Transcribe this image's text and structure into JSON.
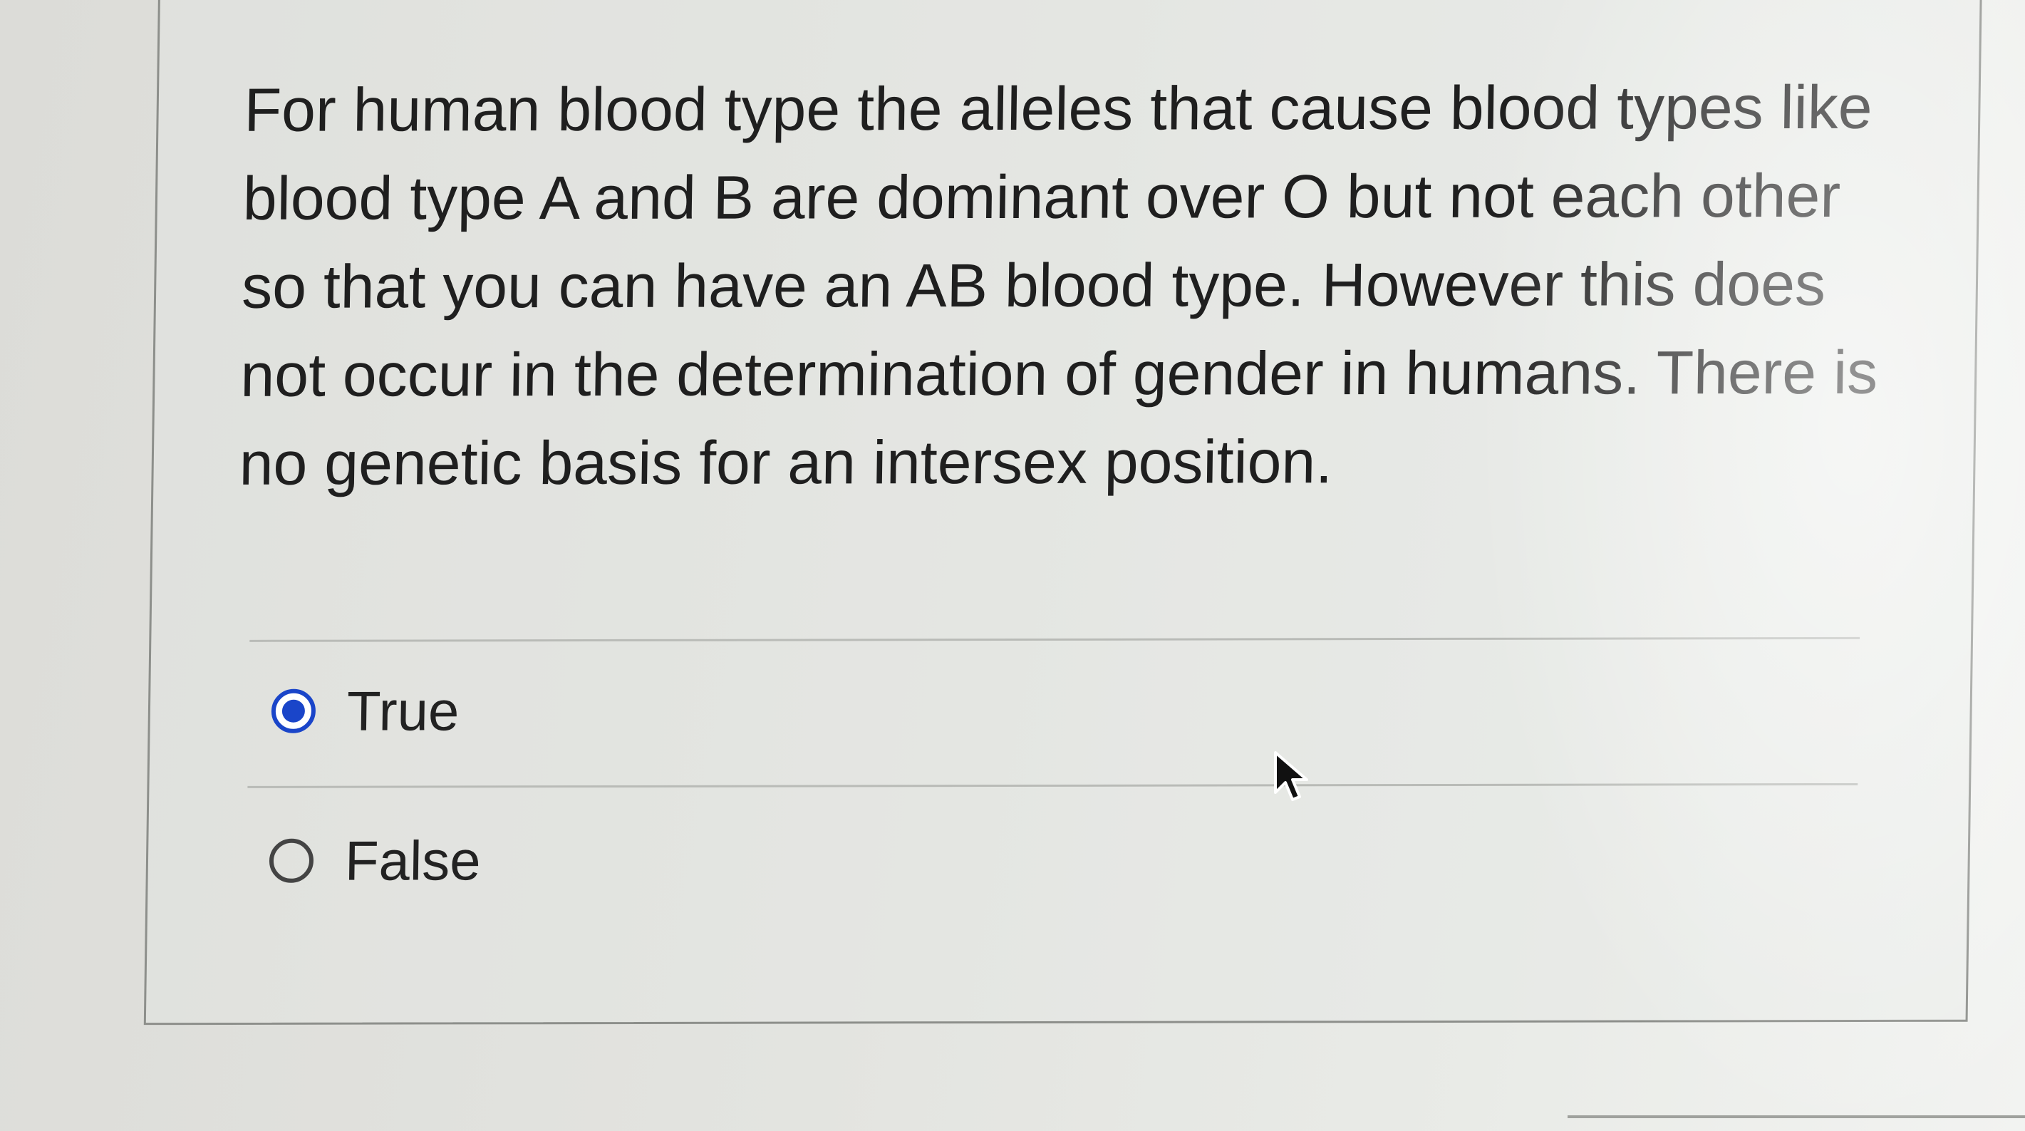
{
  "question": {
    "text": "For human blood type the alleles that cause blood types like blood type A and B are dominant over O but not each other so that you can have an AB blood type. However this does not occur in the determination of gender in humans. There is no genetic basis for an intersex position."
  },
  "options": [
    {
      "label": "True",
      "selected": true
    },
    {
      "label": "False",
      "selected": false
    }
  ],
  "colors": {
    "accent": "#1a45c9",
    "text": "#1f1f1f",
    "border": "#8d8f8b"
  },
  "icons": {
    "cursor": "mouse-pointer-icon"
  }
}
